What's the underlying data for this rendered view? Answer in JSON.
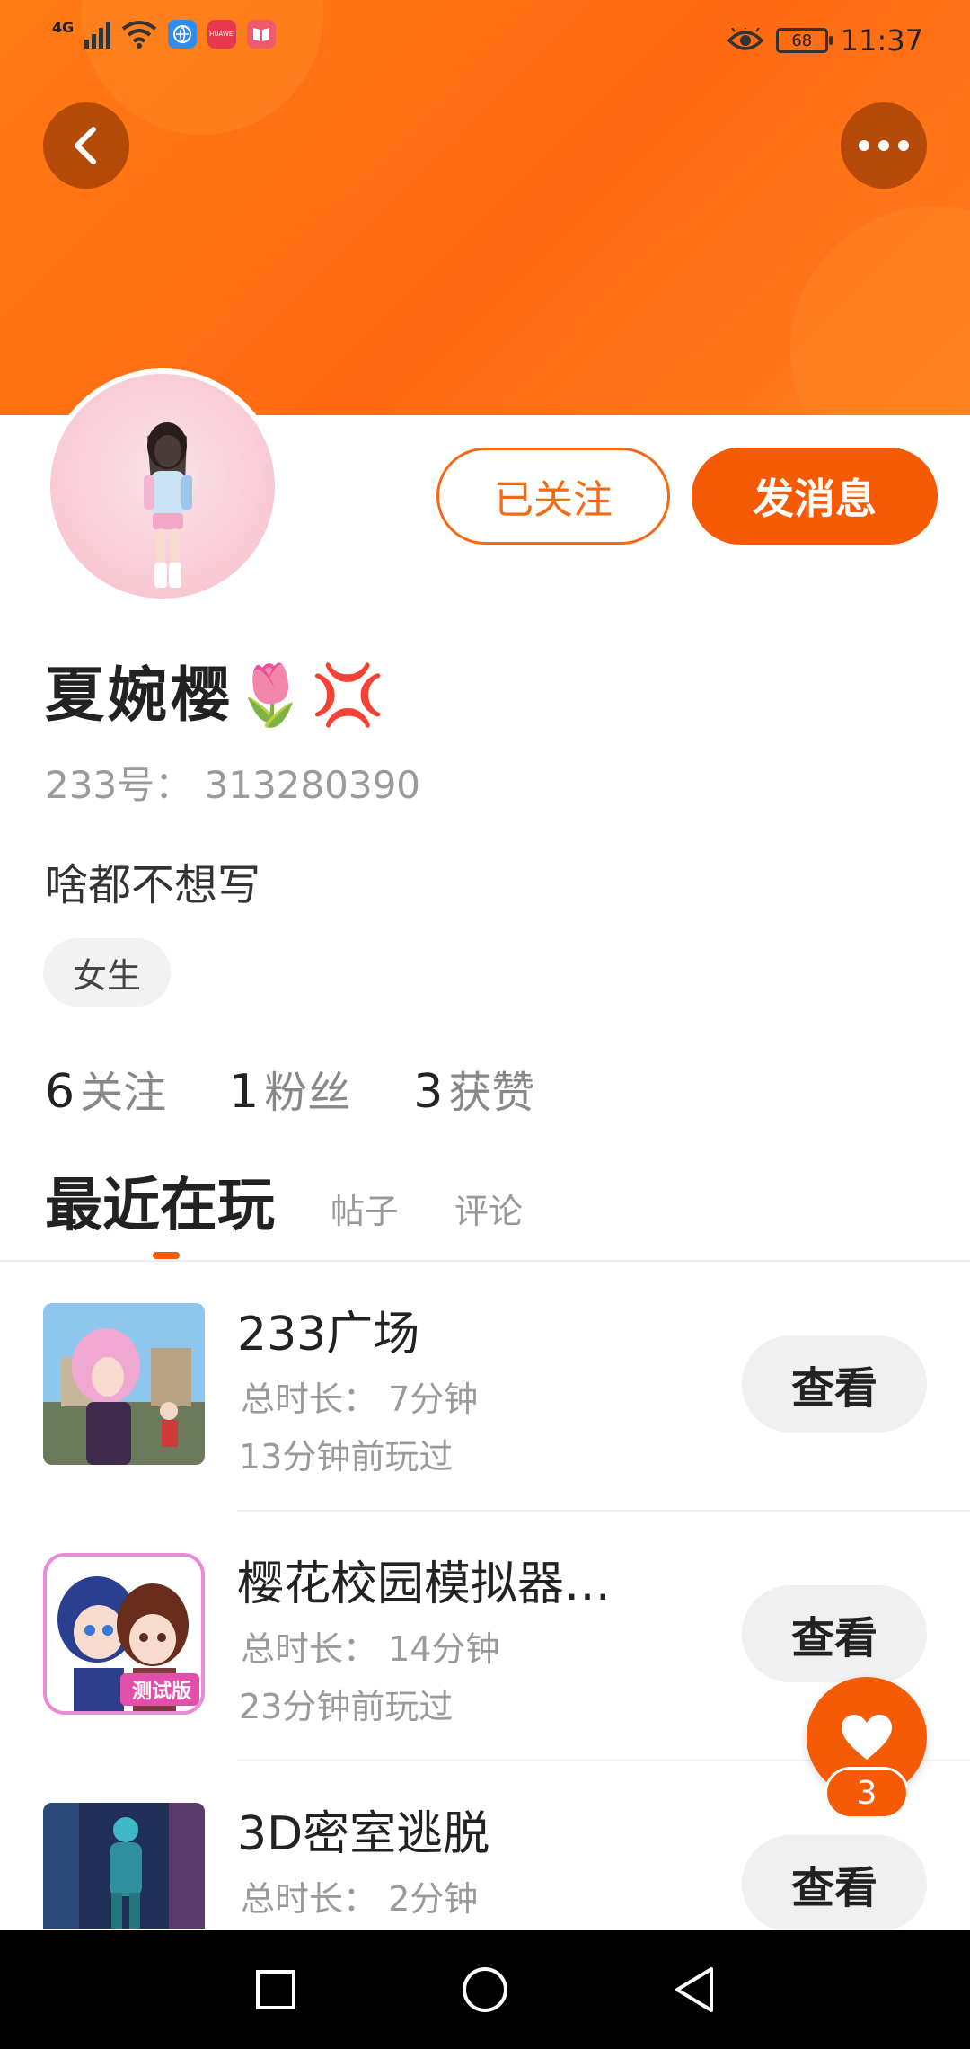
{
  "status_bar": {
    "network": "4G",
    "battery": "68",
    "time": "11:37",
    "icons": [
      "signal-icon",
      "wifi-icon",
      "browser-app-icon",
      "huawei-app-icon",
      "book-app-icon",
      "eye-comfort-icon",
      "battery-icon"
    ],
    "huawei_label": "HUAWEI"
  },
  "header": {
    "back_icon": "chevron-left-icon",
    "more_icon": "more-dots-icon",
    "accent_color": "#ff7414"
  },
  "profile": {
    "name": "夏婉樱🌷💢",
    "id_text": "233号： 313280390",
    "bio": "啥都不想写",
    "gender_tag": "女生",
    "follow_button": "已关注",
    "message_button": "发消息"
  },
  "stats": [
    {
      "count": "6",
      "label": "关注"
    },
    {
      "count": "1",
      "label": "粉丝"
    },
    {
      "count": "3",
      "label": "获赞"
    }
  ],
  "tabs": [
    {
      "label": "最近在玩",
      "active": true
    },
    {
      "label": "帖子",
      "active": false
    },
    {
      "label": "评论",
      "active": false
    }
  ],
  "games": [
    {
      "title": "233广场",
      "duration": "总时长： 7分钟",
      "last_played": "13分钟前玩过",
      "action": "查看"
    },
    {
      "title": "樱花校园模拟器…",
      "duration": "总时长： 14分钟",
      "last_played": "23分钟前玩过",
      "action": "查看",
      "thumb_badge": "测试版"
    },
    {
      "title": "3D密室逃脱",
      "duration": "总时长： 2分钟",
      "last_played": "",
      "action": "查看"
    }
  ],
  "like_fab": {
    "icon": "heart-icon",
    "count": "3"
  },
  "nav_bar": {
    "icons": [
      "recent-apps-icon",
      "home-icon",
      "back-triangle-icon"
    ]
  }
}
